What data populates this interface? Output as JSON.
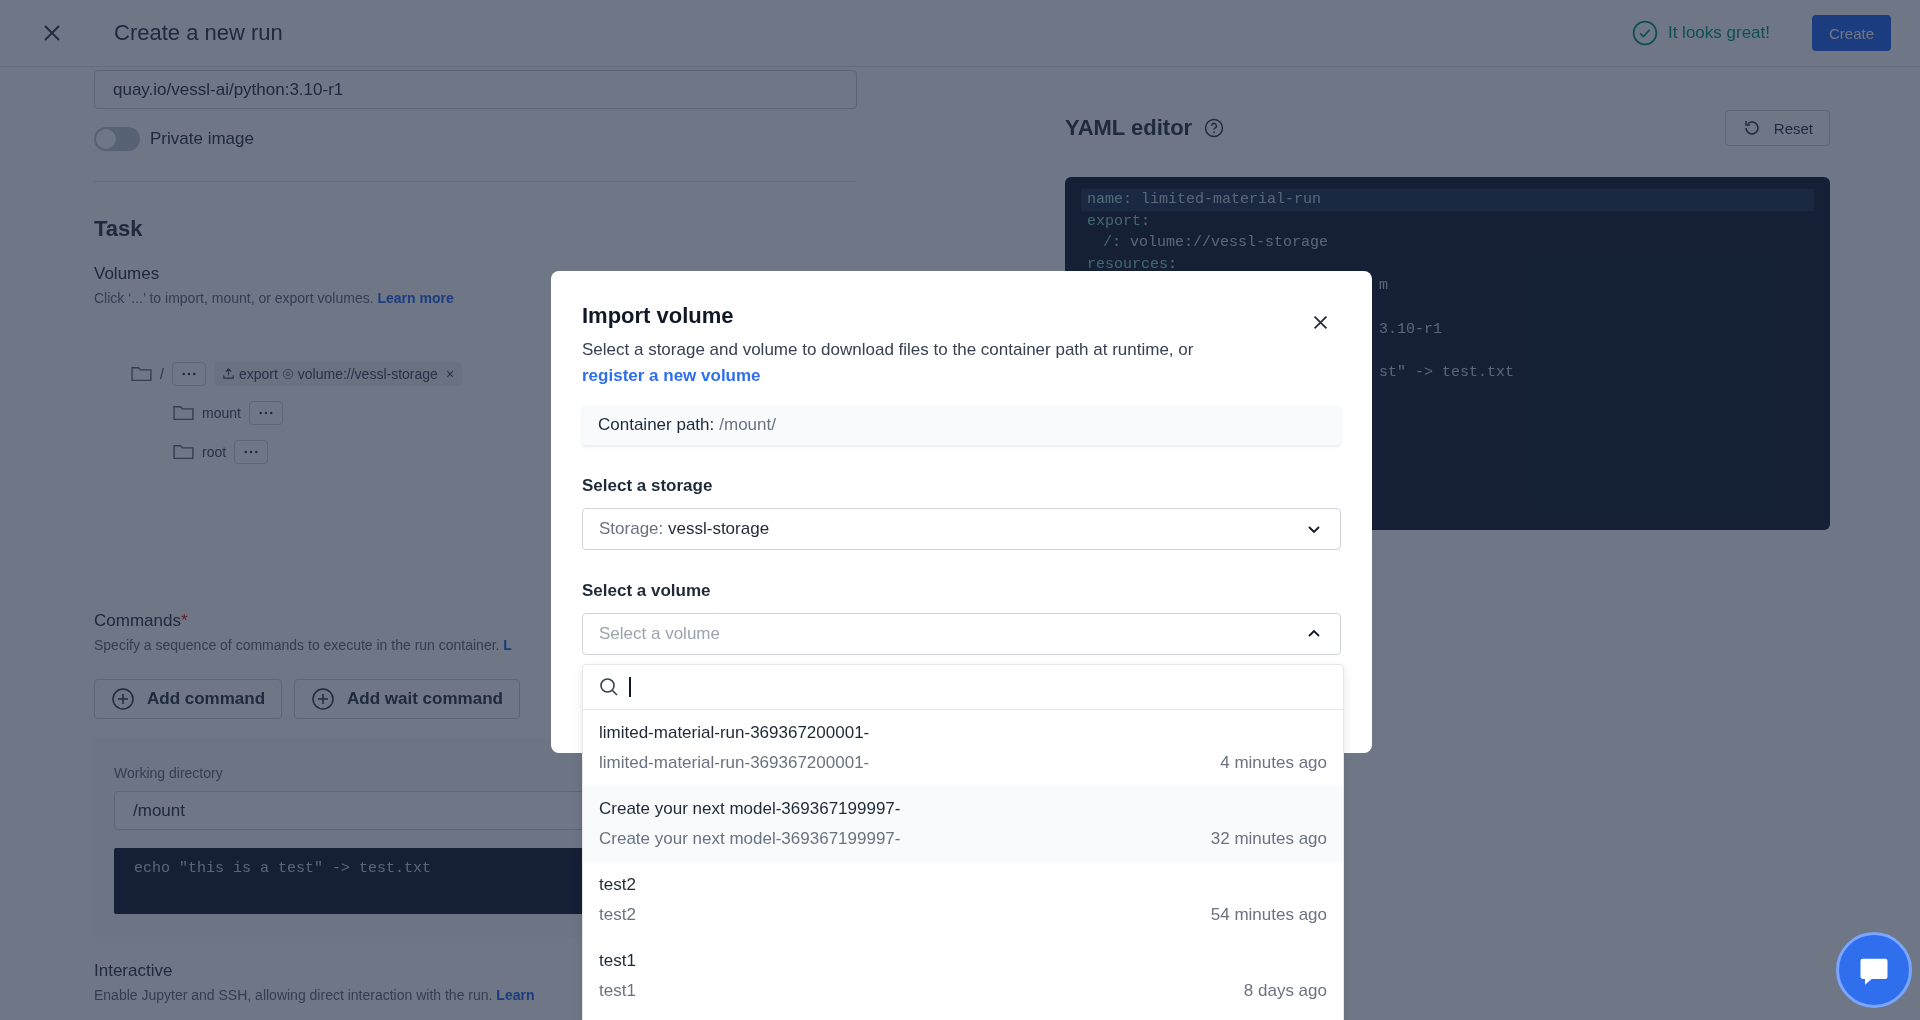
{
  "header": {
    "title": "Create a new run",
    "status": "It looks great!",
    "create_button": "Create"
  },
  "image": {
    "value": "quay.io/vessl-ai/python:3.10-r1",
    "private_label": "Private image",
    "private_on": false
  },
  "task": {
    "title": "Task",
    "volumes": {
      "title": "Volumes",
      "description": "Click ‘...’ to import, mount, or export volumes.",
      "link": "Learn more",
      "tree": {
        "name": "/",
        "chip": {
          "action": "export",
          "target": "volume://vessl-storage",
          "remove": "×"
        },
        "children": [
          {
            "name": "mount"
          },
          {
            "name": "root"
          }
        ]
      }
    },
    "commands": {
      "title": "Commands",
      "required_mark": "*",
      "description": "Specify a sequence of commands to execute in the run container.",
      "link": "L",
      "buttons": [
        "Add command",
        "Add wait command"
      ],
      "working_directory_label": "Working directory",
      "working_directory": "/mount",
      "code": "echo \"this is a test\" -> test.txt"
    },
    "interactive": {
      "title": "Interactive",
      "description": "Enable Jupyter and SSH, allowing direct interaction with the run.",
      "link": "Learn"
    }
  },
  "yaml": {
    "title": "YAML editor",
    "reset": "Reset",
    "lines": [
      {
        "kind": "pair",
        "key": "name",
        "rest": ": limited-material-run",
        "highlighted": true
      },
      {
        "kind": "pair",
        "key": "export",
        "rest": ":",
        "highlighted": false,
        "children": [
          {
            "kind": "pair",
            "key": "/",
            "rest": ": volume://vessl-storage",
            "highlighted": false
          }
        ]
      },
      {
        "kind": "pair",
        "key": "resources",
        "rest": ":",
        "highlighted": false
      },
      {
        "kind": "fragment",
        "text": "m"
      },
      {
        "kind": "covered"
      },
      {
        "kind": "fragment",
        "text": "3.10-r1"
      },
      {
        "kind": "covered"
      },
      {
        "kind": "fragment",
        "text": "st\" -> test.txt"
      }
    ]
  },
  "modal": {
    "title": "Import volume",
    "description": "Select a storage and volume to download files to the container path at runtime, or",
    "link": "register a new volume",
    "container_path_label": "Container path:",
    "container_path": "/mount/",
    "storage_label": "Select a storage",
    "storage_prefix": "Storage:",
    "storage_value": "vessl-storage",
    "volume_label": "Select a volume",
    "volume_placeholder": "Select a volume",
    "volume_expanded": true,
    "options": [
      {
        "title": "limited-material-run-369367200001-",
        "subtitle": "limited-material-run-369367200001-",
        "time": "4 minutes ago",
        "hovered": false
      },
      {
        "title": "Create your next model-369367199997-",
        "subtitle": "Create your next model-369367199997-",
        "time": "32 minutes ago",
        "hovered": true
      },
      {
        "title": "test2",
        "subtitle": "test2",
        "time": "54 minutes ago",
        "hovered": false
      },
      {
        "title": "test1",
        "subtitle": "test1",
        "time": "8 days ago",
        "hovered": false
      }
    ]
  }
}
